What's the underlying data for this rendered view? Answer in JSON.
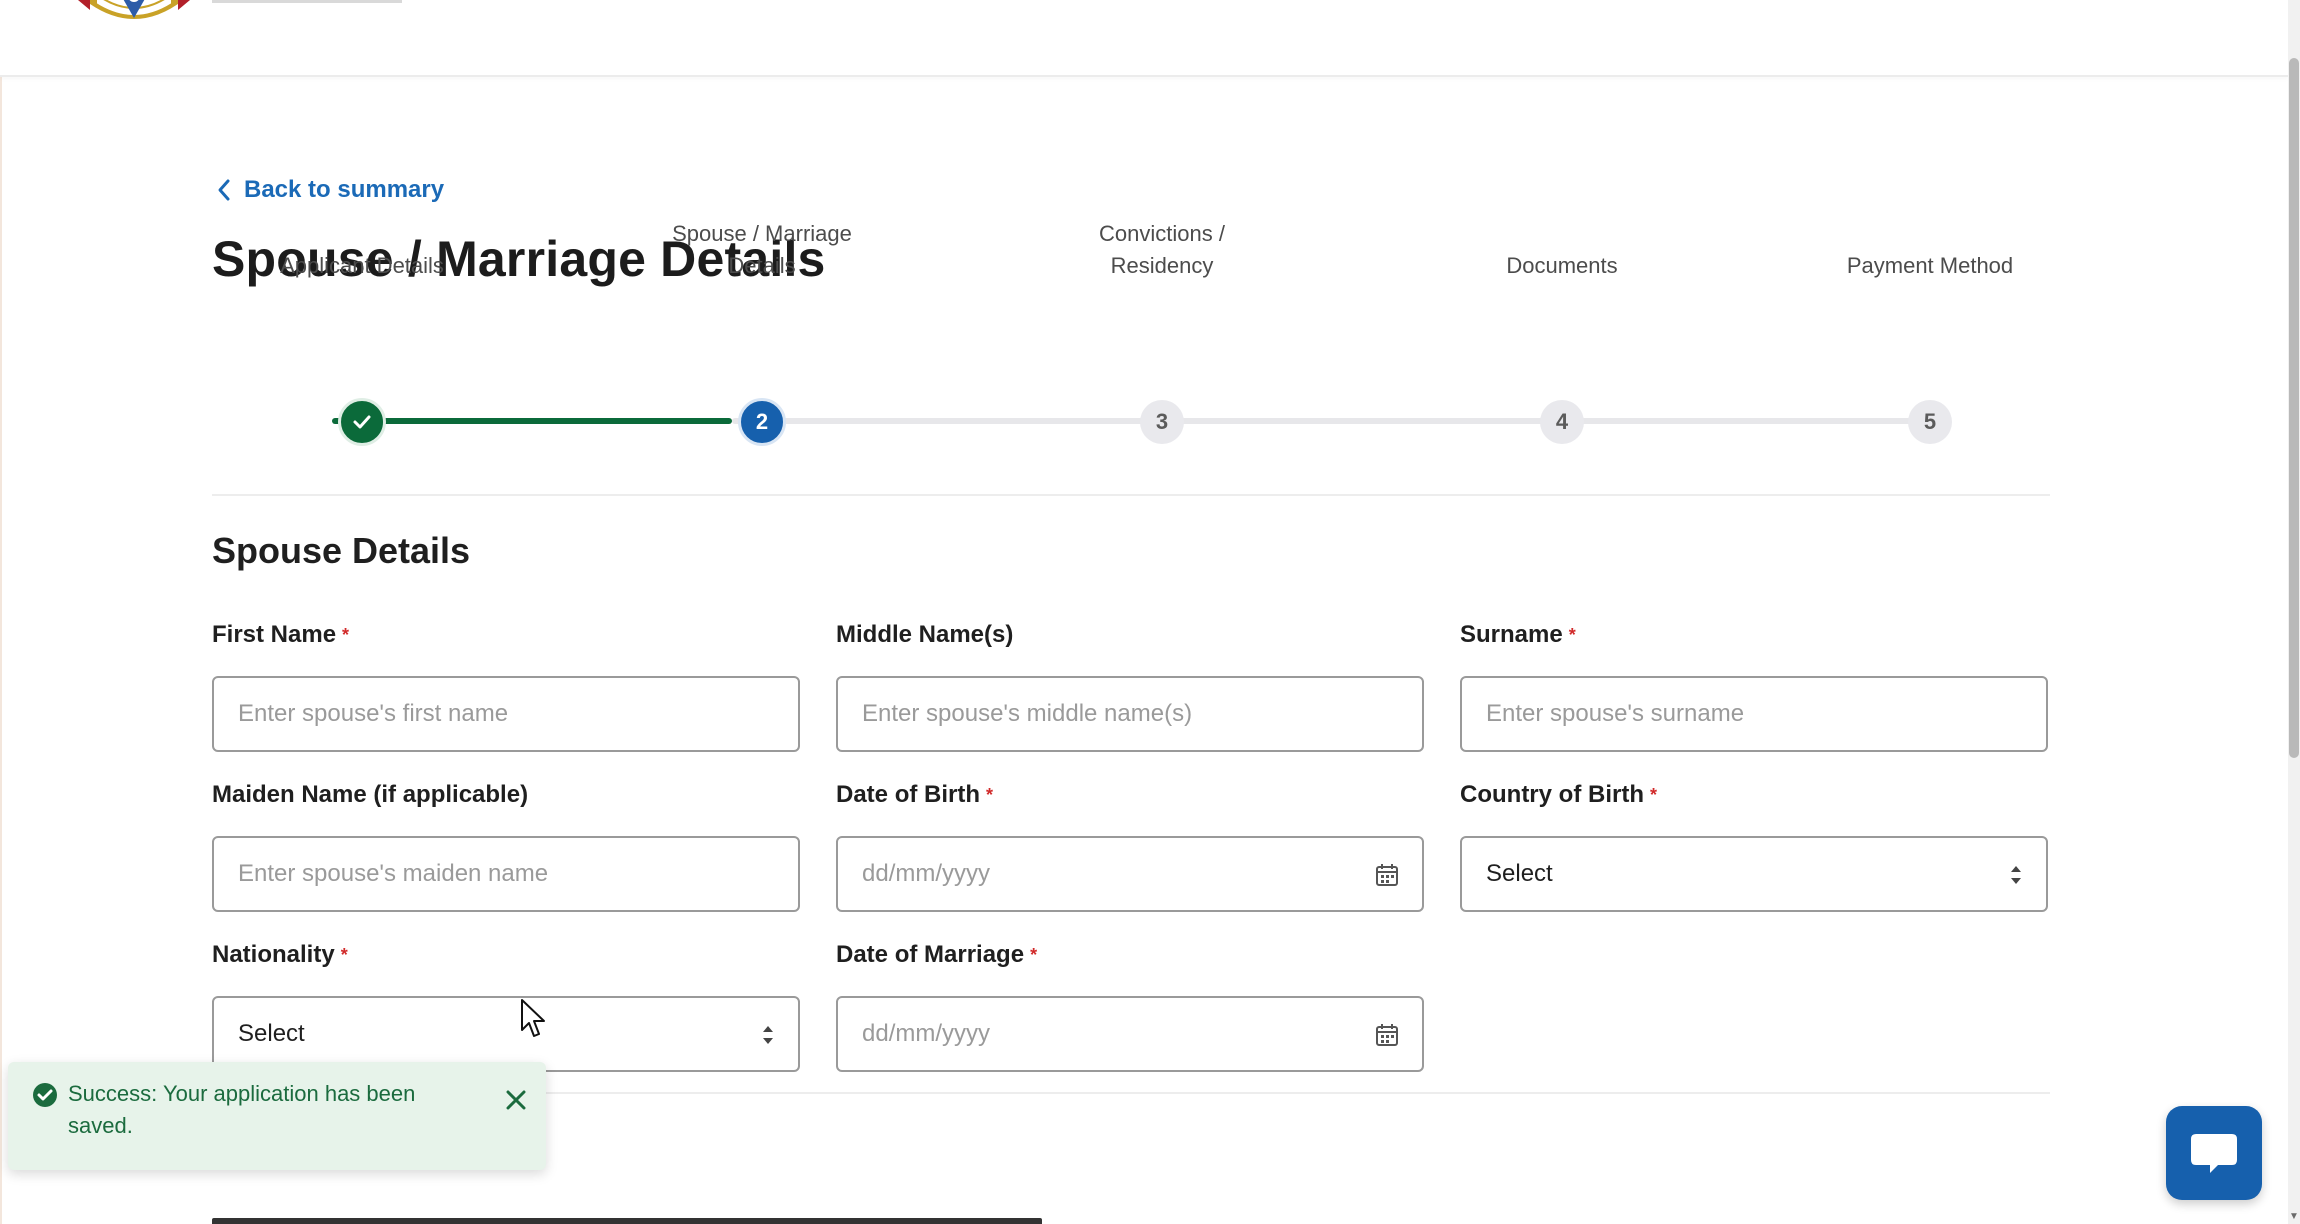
{
  "nav": {
    "back_label": "Back to summary"
  },
  "page": {
    "title": "Spouse / Marriage Details"
  },
  "stepper": {
    "steps": [
      {
        "label": "Applicant Details",
        "number": "",
        "status": "complete"
      },
      {
        "label": "Spouse / Marriage Details",
        "number": "2",
        "status": "current"
      },
      {
        "label": "Convictions / Residency",
        "number": "3",
        "status": "upcoming"
      },
      {
        "label": "Documents",
        "number": "4",
        "status": "upcoming"
      },
      {
        "label": "Payment Method",
        "number": "5",
        "status": "upcoming"
      }
    ]
  },
  "section": {
    "title": "Spouse Details"
  },
  "form": {
    "first_name": {
      "label": "First Name",
      "placeholder": "Enter spouse's first name",
      "required": "*"
    },
    "middle_name": {
      "label": "Middle Name(s)",
      "placeholder": "Enter spouse's middle name(s)"
    },
    "surname": {
      "label": "Surname",
      "placeholder": "Enter spouse's surname",
      "required": "*"
    },
    "maiden_name": {
      "label": "Maiden Name (if applicable)",
      "placeholder": "Enter spouse's maiden name"
    },
    "date_of_birth": {
      "label": "Date of Birth",
      "placeholder": "dd/mm/yyyy",
      "required": "*"
    },
    "country_of_birth": {
      "label": "Country of Birth",
      "value": "Select",
      "required": "*"
    },
    "nationality": {
      "label": "Nationality",
      "value": "Select",
      "required": "*"
    },
    "date_of_marriage": {
      "label": "Date of Marriage",
      "placeholder": "dd/mm/yyyy",
      "required": "*"
    }
  },
  "toast": {
    "message": "Success: Your application has been saved."
  },
  "colors": {
    "primary": "#1660ad",
    "success": "#0b6a3a",
    "link": "#1b6ab7",
    "required": "#d12a2a",
    "toast_bg": "#e7f3ea"
  }
}
